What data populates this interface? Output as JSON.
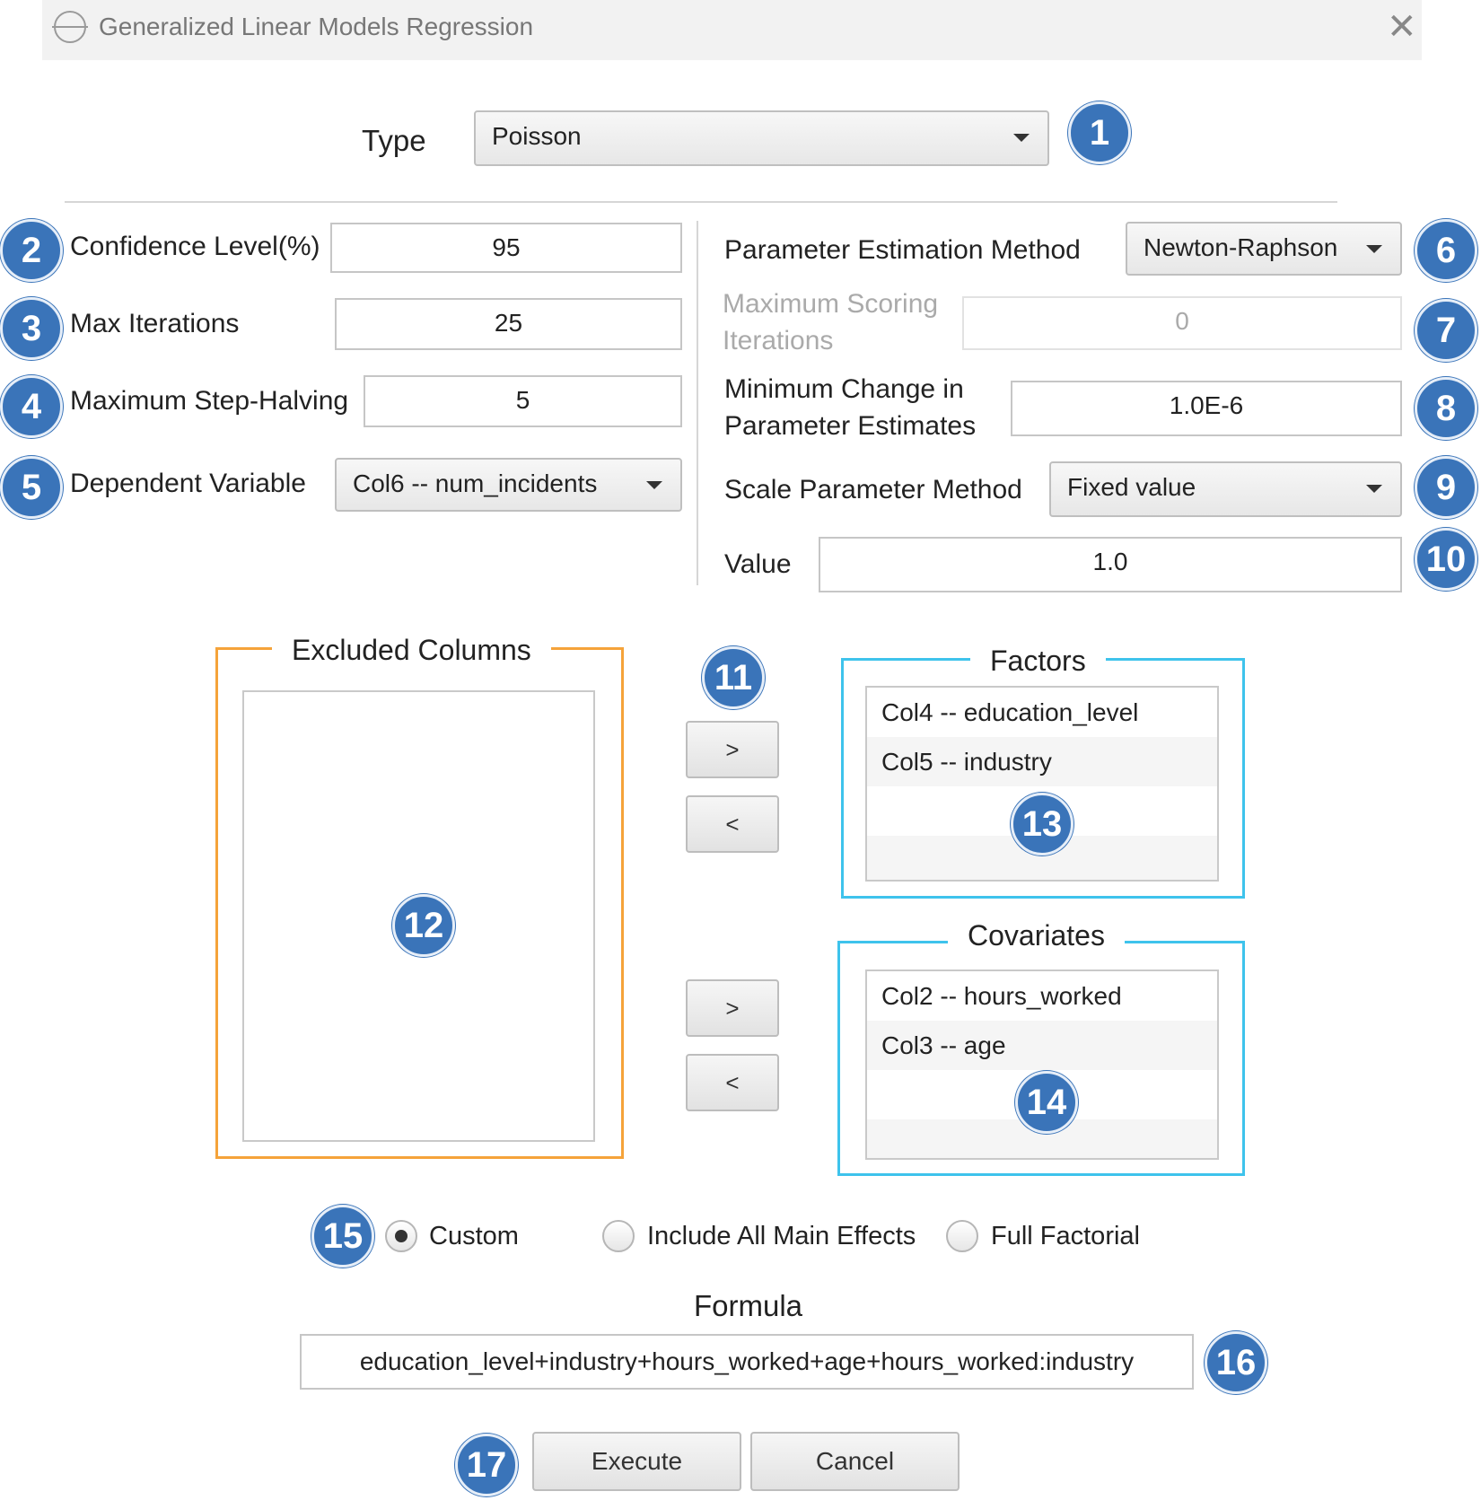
{
  "window": {
    "title": "Generalized Linear Models Regression",
    "close_icon": "close-icon"
  },
  "type_row": {
    "label": "Type",
    "value": "Poisson"
  },
  "left_panel": {
    "confidence_level": {
      "label": "Confidence Level(%)",
      "value": "95"
    },
    "max_iterations": {
      "label": "Max Iterations",
      "value": "25"
    },
    "max_step_halving": {
      "label": "Maximum Step-Halving",
      "value": "5"
    },
    "dependent_variable": {
      "label": "Dependent Variable",
      "value": "Col6 -- num_incidents"
    }
  },
  "right_panel": {
    "param_estimation": {
      "label": "Parameter Estimation Method",
      "value": "Newton-Raphson"
    },
    "max_scoring": {
      "label_line1": "Maximum Scoring",
      "label_line2": "Iterations",
      "value": "0"
    },
    "min_change": {
      "label_line1": "Minimum Change in",
      "label_line2": "Parameter Estimates",
      "value": "1.0E-6"
    },
    "scale_method": {
      "label": "Scale Parameter Method",
      "value": "Fixed value"
    },
    "value": {
      "label": "Value",
      "value": "1.0"
    }
  },
  "excluded": {
    "title": "Excluded Columns",
    "items": []
  },
  "factors": {
    "title": "Factors",
    "items": [
      "Col4 -- education_level",
      "Col5 -- industry"
    ]
  },
  "covariates": {
    "title": "Covariates",
    "items": [
      "Col2 -- hours_worked",
      "Col3 -- age"
    ]
  },
  "move_buttons": {
    "right": ">",
    "left": "<"
  },
  "model_options": {
    "custom": "Custom",
    "main_effects": "Include All Main Effects",
    "full_factorial": "Full Factorial",
    "selected": "custom"
  },
  "formula": {
    "label": "Formula",
    "value": "education_level+industry+hours_worked+age+hours_worked:industry"
  },
  "actions": {
    "execute": "Execute",
    "cancel": "Cancel"
  },
  "badges": [
    "1",
    "2",
    "3",
    "4",
    "5",
    "6",
    "7",
    "8",
    "9",
    "10",
    "11",
    "12",
    "13",
    "14",
    "15",
    "16",
    "17"
  ],
  "colors": {
    "badge": "#3a74b9",
    "excluded_border": "#f5a33a",
    "list_border": "#3ec3ec"
  }
}
